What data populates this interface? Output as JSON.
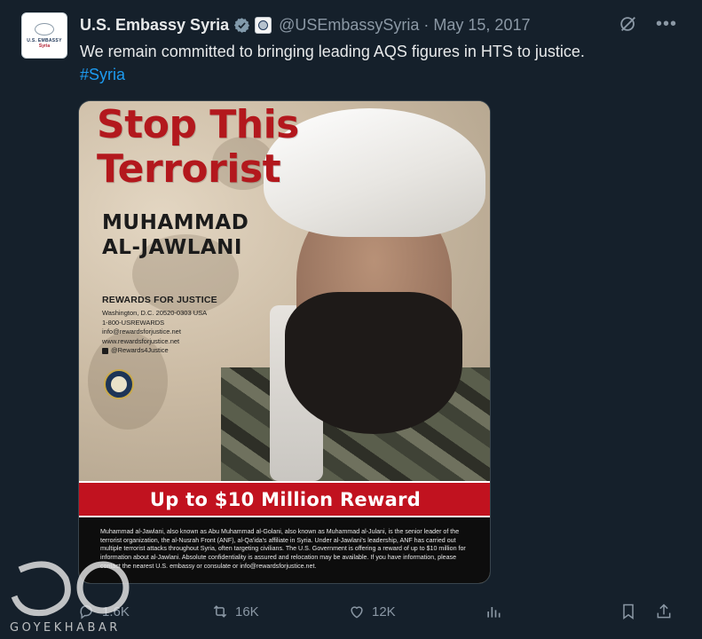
{
  "account": {
    "display_name": "U.S. Embassy Syria",
    "handle": "@USEmbassySyria",
    "separator": "·",
    "date": "May 15, 2017",
    "avatar_text_1": "U.S. EMBASSY",
    "avatar_text_2": "Syria"
  },
  "tweet": {
    "text": "We remain committed to bringing leading AQS figures in HTS to justice.",
    "hashtag": "#Syria"
  },
  "poster": {
    "title_line1": "Stop This",
    "title_line2": "Terrorist",
    "name_line1": "MUHAMMAD",
    "name_line2": "AL-JAWLANI",
    "rfj_title": "REWARDS FOR JUSTICE",
    "rfj_lines": [
      "Washington, D.C. 20520-0303 USA",
      "1-800-USREWARDS",
      "info@rewardsforjustice.net",
      "www.rewardsforjustice.net"
    ],
    "rfj_social": "@Rewards4Justice",
    "reward_banner": "Up to $10 Million Reward",
    "description": "Muhammad al-Jawlani, also known as Abu Muhammad al-Golani, also known as Muhammad al-Julani, is the senior leader of the terrorist organization, the al-Nusrah Front (ANF), al-Qa'ida's affiliate in Syria. Under al-Jawlani's leadership, ANF has carried out multiple terrorist attacks throughout Syria, often targeting civilians. The U.S. Government is offering a reward of up to $10 million for information about al-Jawlani. Absolute confidentiality is assured and relocation may be available. If you have information, please contact the nearest U.S. embassy or consulate or info@rewardsforjustice.net."
  },
  "actions": {
    "replies": "1.6K",
    "retweets": "16K",
    "likes": "12K"
  },
  "watermark": {
    "text": "GOYEKHABAR"
  },
  "colors": {
    "background": "#15202b",
    "accent": "#1d9bf0",
    "muted": "#8b98a5",
    "poster_red": "#c1121f"
  },
  "icons": [
    "verified-badge-icon",
    "government-badge-icon",
    "grok-icon",
    "more-icon",
    "reply-icon",
    "retweet-icon",
    "like-icon",
    "views-icon",
    "bookmark-icon",
    "share-icon"
  ]
}
